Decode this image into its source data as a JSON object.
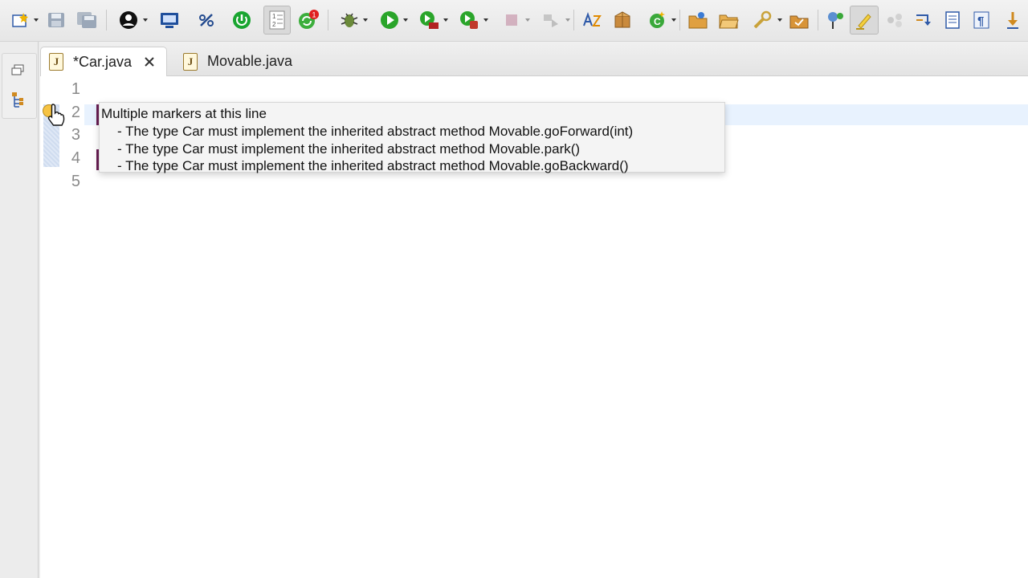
{
  "toolbar": {
    "icons": [
      "new-wizard-icon",
      "save-icon",
      "save-all-icon",
      "profile-icon",
      "terminal-icon",
      "link-icon",
      "power-icon",
      "line-numbers-toggle-icon",
      "sync-notification-icon",
      "debug-icon",
      "run-icon",
      "coverage-icon",
      "external-tools-icon",
      "stop-icon",
      "step-icon",
      "new-java-icon",
      "new-package-icon",
      "new-class-icon",
      "open-type-icon",
      "open-folder-icon",
      "search-icon",
      "open-task-icon",
      "pin-icon",
      "highlight-icon",
      "link-with-editor-icon",
      "show-whitespace-icon",
      "paragraph-icon",
      "next-annotation-icon"
    ],
    "notification_badge": "1"
  },
  "tabs": [
    {
      "label": "*Car.java",
      "active": true,
      "closable": true
    },
    {
      "label": "Movable.java",
      "active": false,
      "closable": false
    }
  ],
  "editor": {
    "line_numbers": [
      "1",
      "2",
      "3",
      "4",
      "5"
    ]
  },
  "tooltip": {
    "title": "Multiple markers at this line",
    "items": [
      "- The type Car must implement the inherited abstract method Movable.goForward(int)",
      "- The type Car must implement the inherited abstract method Movable.park()",
      "- The type Car must implement the inherited abstract method Movable.goBackward()"
    ]
  },
  "colors": {
    "current_line": "#e8f2fe",
    "tooltip_bg": "#f4f4f4",
    "java_icon": "#9c7b2e"
  }
}
